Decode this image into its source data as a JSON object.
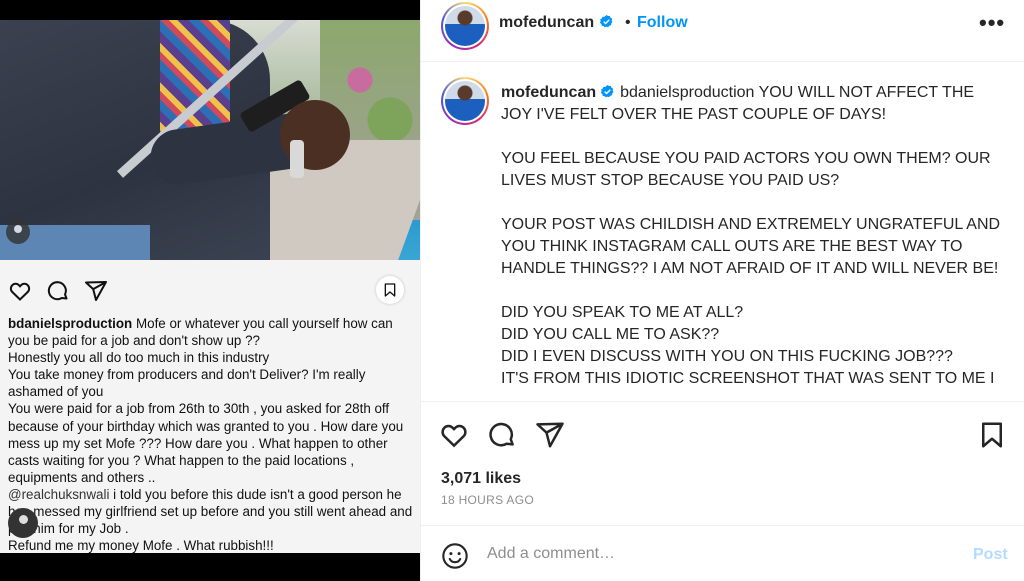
{
  "left_screenshot": {
    "caption_username": "bdanielsproduction",
    "caption_lines": [
      " Mofe or whatever you call yourself how can you be paid for a job and don't show up ??",
      "Honestly you all do too much in this industry",
      "You take money from producers and don't Deliver? I'm really ashamed of  you",
      " You were paid for a job from 26th to 30th , you asked for 28th off because of your birthday which was granted to you . How dare you mess up my set Mofe ??? How dare you . What happen to other casts waiting for you ? What happen to the paid locations , equipments and others .."
    ],
    "mention": "@realchuksnwali",
    "mention_text": "  i told you before this dude isn't a good person he has messed my girlfriend set up before and you still went ahead and pay him for my Job .",
    "final_line": "Refund me my money Mofe . What rubbish!!!"
  },
  "header": {
    "username": "mofeduncan",
    "separator": "•",
    "follow_label": "Follow",
    "more_label": "•••"
  },
  "caption": {
    "username": "mofeduncan",
    "paragraphs": [
      "bdanielsproduction YOU WILL NOT AFFECT THE JOY I'VE FELT OVER THE PAST COUPLE OF DAYS!",
      "YOU FEEL BECAUSE YOU PAID ACTORS YOU OWN THEM? OUR LIVES MUST STOP BECAUSE YOU PAID US?",
      "YOUR POST WAS CHILDISH AND EXTREMELY UNGRATEFUL AND YOU THINK INSTAGRAM CALL OUTS ARE THE BEST WAY TO HANDLE THINGS?? I AM NOT AFRAID OF IT AND WILL NEVER BE!",
      "DID YOU SPEAK TO ME AT ALL?\nDID YOU CALL ME TO ASK??\nDID I EVEN DISCUSS WITH YOU ON THIS FUCKING JOB???\nIT'S FROM THIS IDIOTIC SCREENSHOT THAT WAS SENT TO ME I"
    ]
  },
  "stats": {
    "likes": "3,071 likes",
    "time": "18 HOURS AGO"
  },
  "comment": {
    "placeholder": "Add a comment…",
    "post_label": "Post"
  },
  "icons": {
    "verified_color": "#0095f6",
    "heart": "heart-icon",
    "comment": "comment-icon",
    "share": "share-icon",
    "save": "bookmark-icon",
    "emoji": "emoji-icon"
  }
}
